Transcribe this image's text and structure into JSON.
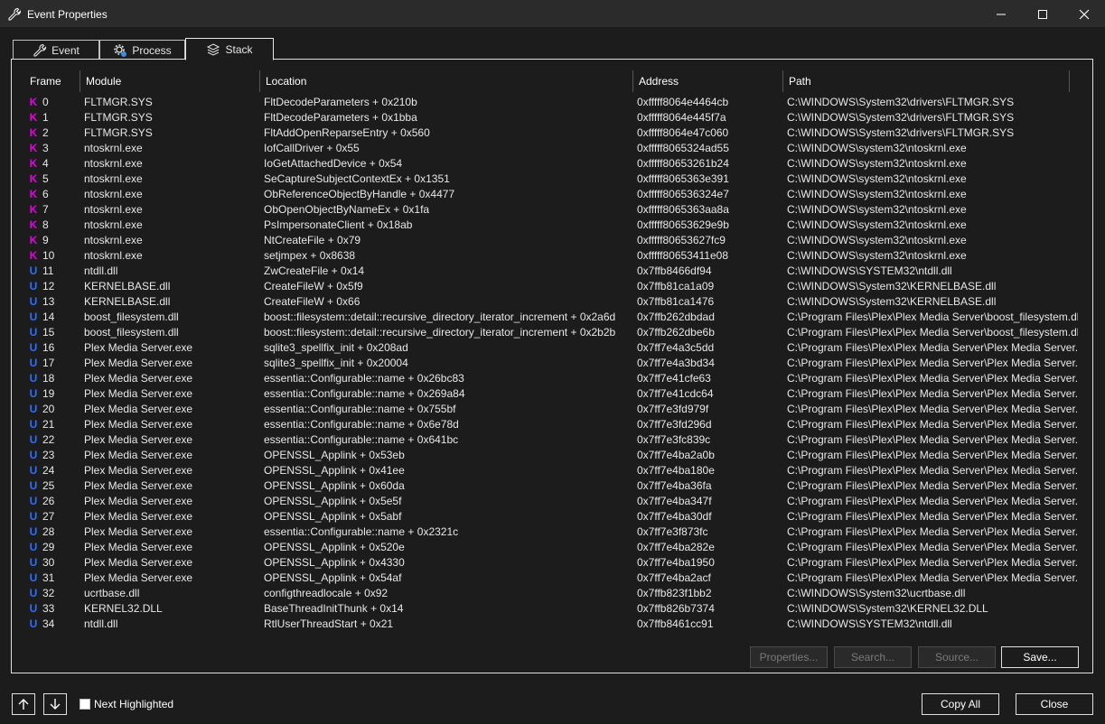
{
  "window": {
    "title": "Event Properties"
  },
  "tabs": [
    {
      "label": "Event",
      "icon": "wrench-icon"
    },
    {
      "label": "Process",
      "icon": "gear-icon"
    },
    {
      "label": "Stack",
      "icon": "layers-icon",
      "active": true
    }
  ],
  "columns": {
    "frame": "Frame",
    "module": "Module",
    "location": "Location",
    "address": "Address",
    "path": "Path"
  },
  "stack": [
    {
      "type": "K",
      "frame": "0",
      "module": "FLTMGR.SYS",
      "location": "FltDecodeParameters + 0x210b",
      "address": "0xfffff8064e4464cb",
      "path": "C:\\WINDOWS\\System32\\drivers\\FLTMGR.SYS"
    },
    {
      "type": "K",
      "frame": "1",
      "module": "FLTMGR.SYS",
      "location": "FltDecodeParameters + 0x1bba",
      "address": "0xfffff8064e445f7a",
      "path": "C:\\WINDOWS\\System32\\drivers\\FLTMGR.SYS"
    },
    {
      "type": "K",
      "frame": "2",
      "module": "FLTMGR.SYS",
      "location": "FltAddOpenReparseEntry + 0x560",
      "address": "0xfffff8064e47c060",
      "path": "C:\\WINDOWS\\System32\\drivers\\FLTMGR.SYS"
    },
    {
      "type": "K",
      "frame": "3",
      "module": "ntoskrnl.exe",
      "location": "IofCallDriver + 0x55",
      "address": "0xfffff8065324ad55",
      "path": "C:\\WINDOWS\\system32\\ntoskrnl.exe"
    },
    {
      "type": "K",
      "frame": "4",
      "module": "ntoskrnl.exe",
      "location": "IoGetAttachedDevice + 0x54",
      "address": "0xfffff80653261b24",
      "path": "C:\\WINDOWS\\system32\\ntoskrnl.exe"
    },
    {
      "type": "K",
      "frame": "5",
      "module": "ntoskrnl.exe",
      "location": "SeCaptureSubjectContextEx + 0x1351",
      "address": "0xfffff8065363e391",
      "path": "C:\\WINDOWS\\system32\\ntoskrnl.exe"
    },
    {
      "type": "K",
      "frame": "6",
      "module": "ntoskrnl.exe",
      "location": "ObReferenceObjectByHandle + 0x4477",
      "address": "0xfffff806536324e7",
      "path": "C:\\WINDOWS\\system32\\ntoskrnl.exe"
    },
    {
      "type": "K",
      "frame": "7",
      "module": "ntoskrnl.exe",
      "location": "ObOpenObjectByNameEx + 0x1fa",
      "address": "0xfffff8065363aa8a",
      "path": "C:\\WINDOWS\\system32\\ntoskrnl.exe"
    },
    {
      "type": "K",
      "frame": "8",
      "module": "ntoskrnl.exe",
      "location": "PsImpersonateClient + 0x18ab",
      "address": "0xfffff80653629e9b",
      "path": "C:\\WINDOWS\\system32\\ntoskrnl.exe"
    },
    {
      "type": "K",
      "frame": "9",
      "module": "ntoskrnl.exe",
      "location": "NtCreateFile + 0x79",
      "address": "0xfffff80653627fc9",
      "path": "C:\\WINDOWS\\system32\\ntoskrnl.exe"
    },
    {
      "type": "K",
      "frame": "10",
      "module": "ntoskrnl.exe",
      "location": "setjmpex + 0x8638",
      "address": "0xfffff80653411e08",
      "path": "C:\\WINDOWS\\system32\\ntoskrnl.exe"
    },
    {
      "type": "U",
      "frame": "11",
      "module": "ntdll.dll",
      "location": "ZwCreateFile + 0x14",
      "address": "0x7ffb8466df94",
      "path": "C:\\WINDOWS\\SYSTEM32\\ntdll.dll"
    },
    {
      "type": "U",
      "frame": "12",
      "module": "KERNELBASE.dll",
      "location": "CreateFileW + 0x5f9",
      "address": "0x7ffb81ca1a09",
      "path": "C:\\WINDOWS\\System32\\KERNELBASE.dll"
    },
    {
      "type": "U",
      "frame": "13",
      "module": "KERNELBASE.dll",
      "location": "CreateFileW + 0x66",
      "address": "0x7ffb81ca1476",
      "path": "C:\\WINDOWS\\System32\\KERNELBASE.dll"
    },
    {
      "type": "U",
      "frame": "14",
      "module": "boost_filesystem.dll",
      "location": "boost::filesystem::detail::recursive_directory_iterator_increment + 0x2a6d",
      "address": "0x7ffb262dbdad",
      "path": "C:\\Program Files\\Plex\\Plex Media Server\\boost_filesystem.dll"
    },
    {
      "type": "U",
      "frame": "15",
      "module": "boost_filesystem.dll",
      "location": "boost::filesystem::detail::recursive_directory_iterator_increment + 0x2b2b",
      "address": "0x7ffb262dbe6b",
      "path": "C:\\Program Files\\Plex\\Plex Media Server\\boost_filesystem.dll"
    },
    {
      "type": "U",
      "frame": "16",
      "module": "Plex Media Server.exe",
      "location": "sqlite3_spellfix_init + 0x208ad",
      "address": "0x7ff7e4a3c5dd",
      "path": "C:\\Program Files\\Plex\\Plex Media Server\\Plex Media Server.exe"
    },
    {
      "type": "U",
      "frame": "17",
      "module": "Plex Media Server.exe",
      "location": "sqlite3_spellfix_init + 0x20004",
      "address": "0x7ff7e4a3bd34",
      "path": "C:\\Program Files\\Plex\\Plex Media Server\\Plex Media Server.exe"
    },
    {
      "type": "U",
      "frame": "18",
      "module": "Plex Media Server.exe",
      "location": "essentia::Configurable::name + 0x26bc83",
      "address": "0x7ff7e41cfe63",
      "path": "C:\\Program Files\\Plex\\Plex Media Server\\Plex Media Server.exe"
    },
    {
      "type": "U",
      "frame": "19",
      "module": "Plex Media Server.exe",
      "location": "essentia::Configurable::name + 0x269a84",
      "address": "0x7ff7e41cdc64",
      "path": "C:\\Program Files\\Plex\\Plex Media Server\\Plex Media Server.exe"
    },
    {
      "type": "U",
      "frame": "20",
      "module": "Plex Media Server.exe",
      "location": "essentia::Configurable::name + 0x755bf",
      "address": "0x7ff7e3fd979f",
      "path": "C:\\Program Files\\Plex\\Plex Media Server\\Plex Media Server.exe"
    },
    {
      "type": "U",
      "frame": "21",
      "module": "Plex Media Server.exe",
      "location": "essentia::Configurable::name + 0x6e78d",
      "address": "0x7ff7e3fd296d",
      "path": "C:\\Program Files\\Plex\\Plex Media Server\\Plex Media Server.exe"
    },
    {
      "type": "U",
      "frame": "22",
      "module": "Plex Media Server.exe",
      "location": "essentia::Configurable::name + 0x641bc",
      "address": "0x7ff7e3fc839c",
      "path": "C:\\Program Files\\Plex\\Plex Media Server\\Plex Media Server.exe"
    },
    {
      "type": "U",
      "frame": "23",
      "module": "Plex Media Server.exe",
      "location": "OPENSSL_Applink + 0x53eb",
      "address": "0x7ff7e4ba2a0b",
      "path": "C:\\Program Files\\Plex\\Plex Media Server\\Plex Media Server.exe"
    },
    {
      "type": "U",
      "frame": "24",
      "module": "Plex Media Server.exe",
      "location": "OPENSSL_Applink + 0x41ee",
      "address": "0x7ff7e4ba180e",
      "path": "C:\\Program Files\\Plex\\Plex Media Server\\Plex Media Server.exe"
    },
    {
      "type": "U",
      "frame": "25",
      "module": "Plex Media Server.exe",
      "location": "OPENSSL_Applink + 0x60da",
      "address": "0x7ff7e4ba36fa",
      "path": "C:\\Program Files\\Plex\\Plex Media Server\\Plex Media Server.exe"
    },
    {
      "type": "U",
      "frame": "26",
      "module": "Plex Media Server.exe",
      "location": "OPENSSL_Applink + 0x5e5f",
      "address": "0x7ff7e4ba347f",
      "path": "C:\\Program Files\\Plex\\Plex Media Server\\Plex Media Server.exe"
    },
    {
      "type": "U",
      "frame": "27",
      "module": "Plex Media Server.exe",
      "location": "OPENSSL_Applink + 0x5abf",
      "address": "0x7ff7e4ba30df",
      "path": "C:\\Program Files\\Plex\\Plex Media Server\\Plex Media Server.exe"
    },
    {
      "type": "U",
      "frame": "28",
      "module": "Plex Media Server.exe",
      "location": "essentia::Configurable::name + 0x2321c",
      "address": "0x7ff7e3f873fc",
      "path": "C:\\Program Files\\Plex\\Plex Media Server\\Plex Media Server.exe"
    },
    {
      "type": "U",
      "frame": "29",
      "module": "Plex Media Server.exe",
      "location": "OPENSSL_Applink + 0x520e",
      "address": "0x7ff7e4ba282e",
      "path": "C:\\Program Files\\Plex\\Plex Media Server\\Plex Media Server.exe"
    },
    {
      "type": "U",
      "frame": "30",
      "module": "Plex Media Server.exe",
      "location": "OPENSSL_Applink + 0x4330",
      "address": "0x7ff7e4ba1950",
      "path": "C:\\Program Files\\Plex\\Plex Media Server\\Plex Media Server.exe"
    },
    {
      "type": "U",
      "frame": "31",
      "module": "Plex Media Server.exe",
      "location": "OPENSSL_Applink + 0x54af",
      "address": "0x7ff7e4ba2acf",
      "path": "C:\\Program Files\\Plex\\Plex Media Server\\Plex Media Server.exe"
    },
    {
      "type": "U",
      "frame": "32",
      "module": "ucrtbase.dll",
      "location": "configthreadlocale + 0x92",
      "address": "0x7ffb823f1bb2",
      "path": "C:\\WINDOWS\\System32\\ucrtbase.dll"
    },
    {
      "type": "U",
      "frame": "33",
      "module": "KERNEL32.DLL",
      "location": "BaseThreadInitThunk + 0x14",
      "address": "0x7ffb826b7374",
      "path": "C:\\WINDOWS\\System32\\KERNEL32.DLL"
    },
    {
      "type": "U",
      "frame": "34",
      "module": "ntdll.dll",
      "location": "RtlUserThreadStart + 0x21",
      "address": "0x7ffb8461cc91",
      "path": "C:\\WINDOWS\\SYSTEM32\\ntdll.dll"
    }
  ],
  "panel_buttons": {
    "properties": "Properties...",
    "search": "Search...",
    "source": "Source...",
    "save": "Save..."
  },
  "footer": {
    "next_highlighted": "Next Highlighted",
    "copy_all": "Copy All",
    "close": "Close"
  },
  "colors": {
    "kernel": "#e000e0",
    "user": "#2e6fff",
    "background": "#1c1c1c"
  }
}
